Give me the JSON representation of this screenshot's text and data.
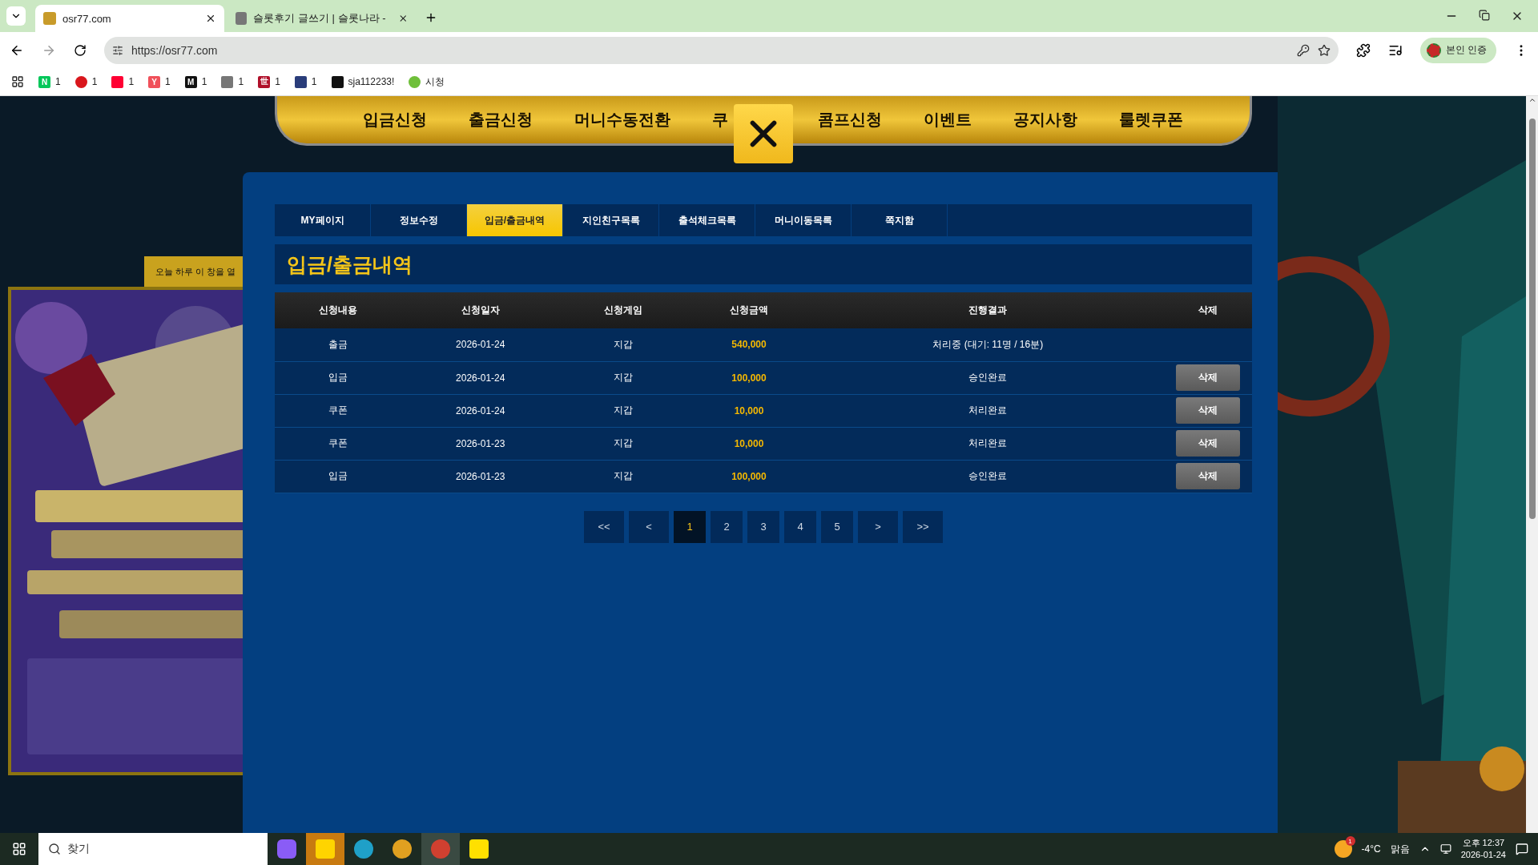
{
  "browser": {
    "tabs": [
      {
        "title": "osr77.com",
        "selected": true
      },
      {
        "title": "슬롯후기 글쓰기 | 슬롯나라 -",
        "selected": false
      }
    ],
    "url": "https://osr77.com",
    "profile_label": "본인 인증",
    "bookmarks": [
      {
        "mark": "N",
        "color": "#03c75a",
        "label": "1"
      },
      {
        "color": "#d9161c",
        "label": "1"
      },
      {
        "color": "#ff0033",
        "label": "1"
      },
      {
        "mark": "Y",
        "color": "#f0505a",
        "label": "1"
      },
      {
        "mark": "M",
        "color": "#111111",
        "label": "1"
      },
      {
        "color": "#777777",
        "label": "1"
      },
      {
        "mark": "世",
        "color": "#b0102a",
        "label": "1"
      },
      {
        "color": "#2a3d7a",
        "label": "1"
      },
      {
        "color": "#111111",
        "label": "sja112233!"
      },
      {
        "color": "#6fbf3a",
        "label": "시청"
      }
    ]
  },
  "nav": {
    "items": [
      "입금신청",
      "출금신청",
      "머니수동전환",
      "쿠",
      "콤프신청",
      "이벤트",
      "공지사항",
      "룰렛쿠폰"
    ]
  },
  "popup": {
    "hide_today_label": "오늘 하루 이 창을 열",
    "kind": "picture"
  },
  "subtabs": [
    {
      "label": "MY페이지",
      "selected": false
    },
    {
      "label": "정보수정",
      "selected": false
    },
    {
      "label": "입금/출금내역",
      "selected": true
    },
    {
      "label": "지인친구목록",
      "selected": false
    },
    {
      "label": "출석체크목록",
      "selected": false
    },
    {
      "label": "머니이동목록",
      "selected": false
    },
    {
      "label": "쪽지함",
      "selected": false
    }
  ],
  "section_title": "입금/출금내역",
  "table": {
    "columns": [
      "신청내용",
      "신청일자",
      "신청게임",
      "신청금액",
      "진행결과",
      "삭제"
    ],
    "rows": [
      {
        "type": "출금",
        "date": "2026-01-24",
        "game": "지갑",
        "amount": "540,000",
        "result": "처리중 (대기: 11명 / 16분)"
      },
      {
        "type": "입금",
        "date": "2026-01-24",
        "game": "지갑",
        "amount": "100,000",
        "result": "승인완료",
        "action": "삭제"
      },
      {
        "type": "쿠폰",
        "date": "2026-01-24",
        "game": "지갑",
        "amount": "10,000",
        "result": "처리완료",
        "action": "삭제"
      },
      {
        "type": "쿠폰",
        "date": "2026-01-23",
        "game": "지갑",
        "amount": "10,000",
        "result": "처리완료",
        "action": "삭제"
      },
      {
        "type": "입금",
        "date": "2026-01-23",
        "game": "지갑",
        "amount": "100,000",
        "result": "승인완료",
        "action": "삭제"
      }
    ]
  },
  "pagination": [
    {
      "label": "<<",
      "kind": "nav",
      "selected": false
    },
    {
      "label": "<",
      "kind": "nav",
      "selected": false
    },
    {
      "label": "1",
      "kind": "page",
      "selected": true
    },
    {
      "label": "2",
      "kind": "page",
      "selected": false
    },
    {
      "label": "3",
      "kind": "page",
      "selected": false
    },
    {
      "label": "4",
      "kind": "page",
      "selected": false
    },
    {
      "label": "5",
      "kind": "page",
      "selected": false
    },
    {
      "label": ">",
      "kind": "nav",
      "selected": false
    },
    {
      "label": ">>",
      "kind": "nav",
      "selected": false
    }
  ],
  "taskbar": {
    "search_placeholder": "찾기",
    "weather_badge": "1",
    "temperature": "-4°C",
    "condition": "맑음",
    "time": "오후 12:37",
    "date": "2026-01-24"
  }
}
